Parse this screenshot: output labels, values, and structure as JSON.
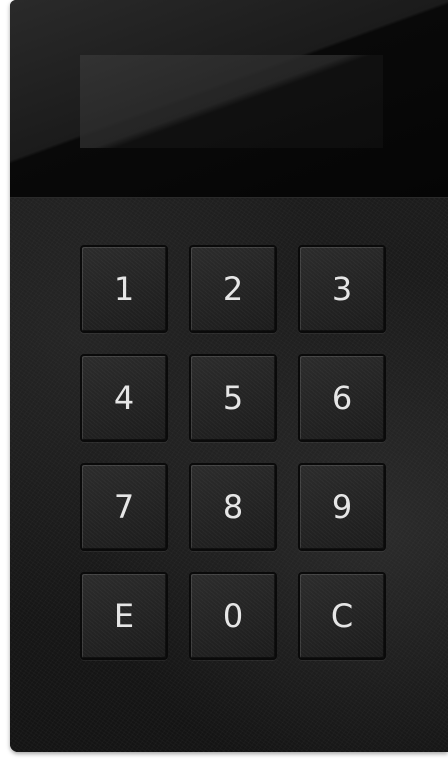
{
  "display": {
    "readout": ""
  },
  "keypad": {
    "keys": [
      {
        "id": "1",
        "label": "1"
      },
      {
        "id": "2",
        "label": "2"
      },
      {
        "id": "3",
        "label": "3"
      },
      {
        "id": "4",
        "label": "4"
      },
      {
        "id": "5",
        "label": "5"
      },
      {
        "id": "6",
        "label": "6"
      },
      {
        "id": "7",
        "label": "7"
      },
      {
        "id": "8",
        "label": "8"
      },
      {
        "id": "9",
        "label": "9"
      },
      {
        "id": "e",
        "label": "E"
      },
      {
        "id": "0",
        "label": "0"
      },
      {
        "id": "c",
        "label": "C"
      }
    ]
  },
  "colors": {
    "panel": "#161616",
    "key_label": "#e6e6e6"
  }
}
